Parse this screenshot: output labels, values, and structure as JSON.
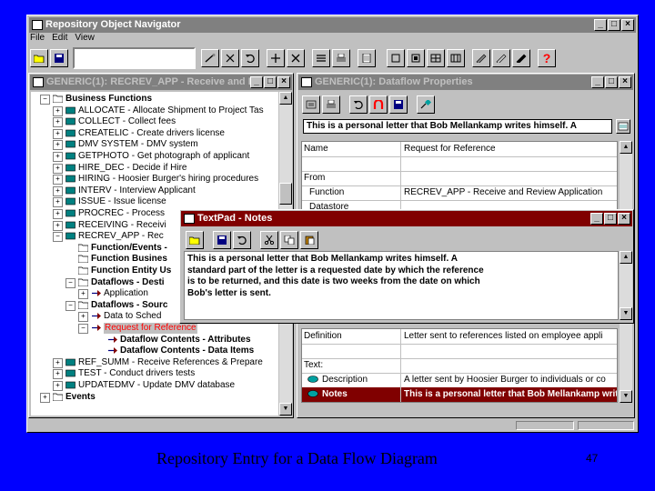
{
  "main_window": {
    "title": "Repository Object Navigator",
    "menu": [
      "File",
      "Edit",
      "View"
    ]
  },
  "navigator": {
    "title": "GENERIC(1): RECREV_APP - Receive and R...",
    "tree": [
      {
        "label": "Business Functions",
        "bold": true,
        "level": 0,
        "toggle": "-"
      },
      {
        "label": "ALLOCATE - Allocate Shipment to Project Tas",
        "level": 1,
        "toggle": "+"
      },
      {
        "label": "COLLECT - Collect fees",
        "level": 1,
        "toggle": "+"
      },
      {
        "label": "CREATELIC - Create drivers license",
        "level": 1,
        "toggle": "+"
      },
      {
        "label": "DMV SYSTEM - DMV system",
        "level": 1,
        "toggle": "+"
      },
      {
        "label": "GETPHOTO - Get photograph of applicant",
        "level": 1,
        "toggle": "+"
      },
      {
        "label": "HIRE_DEC - Decide if Hire",
        "level": 1,
        "toggle": "+"
      },
      {
        "label": "HIRING - Hoosier Burger's hiring procedures",
        "level": 1,
        "toggle": "+"
      },
      {
        "label": "INTERV - Interview Applicant",
        "level": 1,
        "toggle": "+"
      },
      {
        "label": "ISSUE - Issue license",
        "level": 1,
        "toggle": "+"
      },
      {
        "label": "PROCREC - Process",
        "level": 1,
        "toggle": "+"
      },
      {
        "label": "RECEIVING - Receivi",
        "level": 1,
        "toggle": "+"
      },
      {
        "label": "RECREV_APP - Rec",
        "level": 1,
        "toggle": "-"
      },
      {
        "label": "Function/Events -",
        "bold": true,
        "level": 2,
        "toggle": ""
      },
      {
        "label": "Function Busines",
        "bold": true,
        "level": 2,
        "toggle": ""
      },
      {
        "label": "Function Entity Us",
        "bold": true,
        "level": 2,
        "toggle": ""
      },
      {
        "label": "Dataflows - Desti",
        "bold": true,
        "level": 2,
        "toggle": "-"
      },
      {
        "label": "Application",
        "level": 3,
        "toggle": "+"
      },
      {
        "label": "Dataflows - Sourc",
        "bold": true,
        "level": 2,
        "toggle": "-"
      },
      {
        "label": "Data to Sched",
        "level": 3,
        "toggle": "+"
      },
      {
        "label": "Request for Reference",
        "level": 3,
        "toggle": "-",
        "selected": true
      },
      {
        "label": "Dataflow Contents - Attributes",
        "bold": true,
        "level": 4,
        "toggle": ""
      },
      {
        "label": "Dataflow Contents - Data Items",
        "bold": true,
        "level": 4,
        "toggle": ""
      },
      {
        "label": "REF_SUMM - Receive References & Prepare",
        "level": 1,
        "toggle": "+"
      },
      {
        "label": "TEST - Conduct drivers tests",
        "level": 1,
        "toggle": "+"
      },
      {
        "label": "UPDATEDMV - Update DMV database",
        "level": 1,
        "toggle": "+"
      },
      {
        "label": "Events",
        "bold": true,
        "level": 0,
        "toggle": "+"
      }
    ]
  },
  "properties": {
    "title": "GENERIC(1): Dataflow Properties",
    "value_bar": "This is a personal letter that Bob Mellankamp writes himself.  A",
    "rows_top": [
      {
        "name": "Name",
        "value": "Request for Reference"
      },
      {
        "name": "",
        "value": ""
      },
      {
        "name": "From",
        "value": ""
      },
      {
        "name": "Function",
        "value": "RECREV_APP - Receive and Review Application"
      },
      {
        "name": "Datastore",
        "value": ""
      }
    ],
    "rows_bottom": [
      {
        "name": "Definition",
        "value": "Letter sent to references listed on employee appli"
      },
      {
        "name": "",
        "value": ""
      },
      {
        "name": "Text:",
        "value": ""
      },
      {
        "name": "Description",
        "value": "A letter sent by Hoosier Burger to individuals or co"
      },
      {
        "name": "Notes",
        "value": "This is a personal letter that Bob Mellankamp write",
        "selected": true
      }
    ]
  },
  "textpad": {
    "title": "TextPad - Notes",
    "lines": [
      "This is a personal letter that Bob Mellankamp writes himself.  A",
      "standard part of the letter is a requested date by which the reference",
      "is to be returned, and this date is two weeks from the date on which",
      "Bob's letter is sent."
    ]
  },
  "caption": "Repository Entry for a Data Flow Diagram",
  "slide_number": "47",
  "colors": {
    "background": "#0000ff",
    "active_title": "#800000",
    "inactive_title": "#808080",
    "selection": "#800000",
    "selected_tree_text": "#ff0000",
    "toolbar_accent_red": "#ff0000"
  }
}
